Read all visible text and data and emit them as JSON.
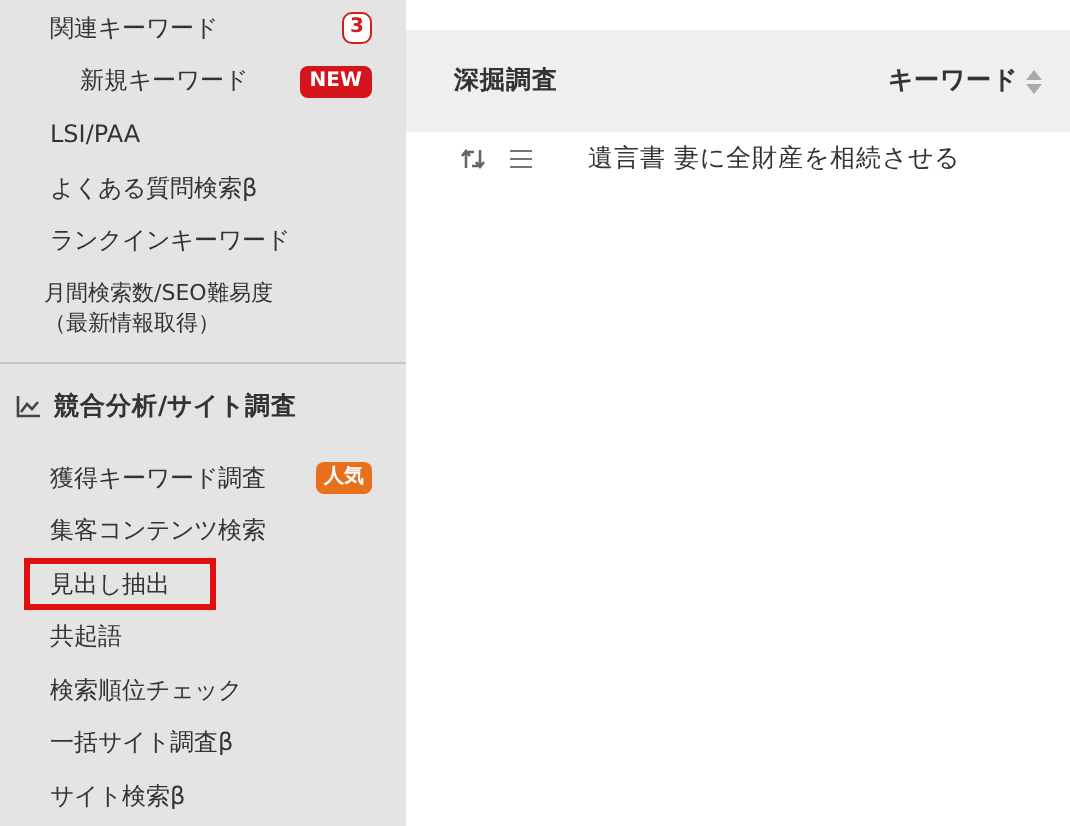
{
  "sidebar": {
    "items": [
      {
        "kind": "item",
        "label": "関連キーワード",
        "badge": {
          "text": "3",
          "kind": "count"
        }
      },
      {
        "kind": "sub",
        "label": "新規キーワード",
        "badge": {
          "text": "NEW",
          "kind": "new"
        }
      },
      {
        "kind": "item",
        "label": "LSI/PAA"
      },
      {
        "kind": "item",
        "label": "よくある質問検索β"
      },
      {
        "kind": "item",
        "label": "ランクインキーワード"
      },
      {
        "kind": "two_line",
        "lines": [
          "月間検索数/SEO難易度",
          "（最新情報取得）"
        ]
      }
    ],
    "section": {
      "title": "競合分析/サイト調査",
      "items": [
        {
          "label": "獲得キーワード調査",
          "highlighted": false,
          "badge": {
            "text": "人気",
            "kind": "popular"
          }
        },
        {
          "label": "集客コンテンツ検索",
          "highlighted": false
        },
        {
          "label": "見出し抽出",
          "highlighted": true
        },
        {
          "label": "共起語",
          "highlighted": false
        },
        {
          "label": "検索順位チェック",
          "highlighted": false
        },
        {
          "label": "一括サイト調査β",
          "highlighted": false
        },
        {
          "label": "サイト検索β",
          "highlighted": false
        }
      ]
    }
  },
  "table": {
    "columns": [
      "深掘調査",
      "キーワード"
    ],
    "rows": [
      {
        "keyword": "遺言書 妻に全財産を相続させる"
      }
    ]
  }
}
